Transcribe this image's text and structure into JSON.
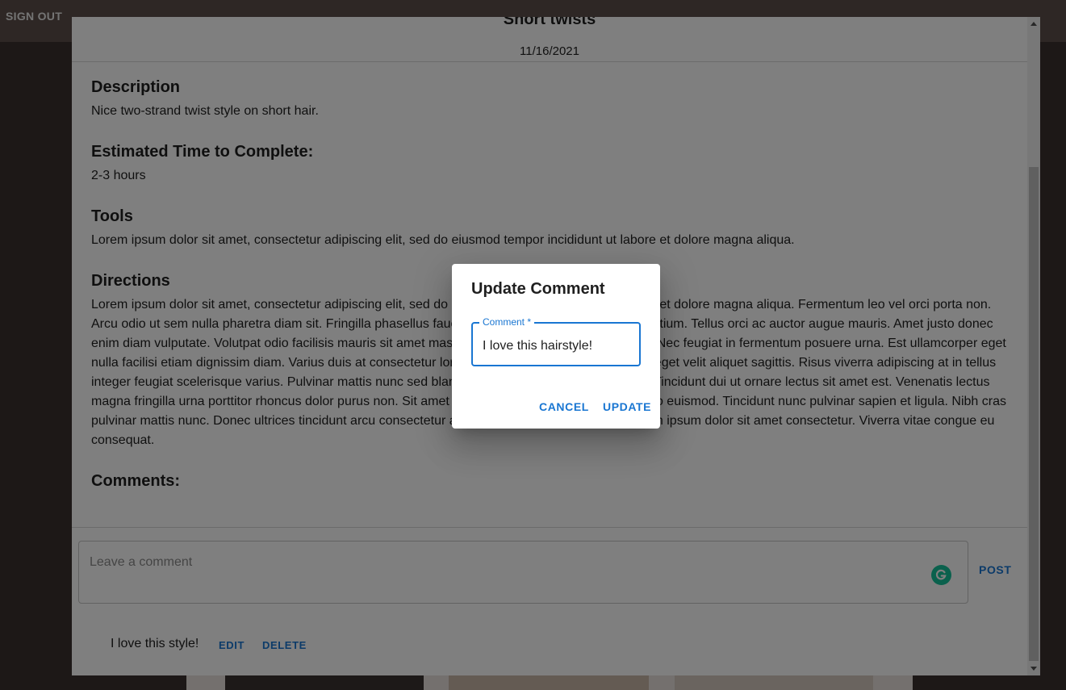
{
  "app_bar": {
    "signout_label": "SIGN OUT"
  },
  "recipe": {
    "title": "Short twists",
    "date": "11/16/2021",
    "sections": {
      "description": {
        "heading": "Description",
        "body": "Nice two-strand twist style on short hair."
      },
      "time": {
        "heading": "Estimated Time to Complete:",
        "body": "2-3 hours"
      },
      "tools": {
        "heading": "Tools",
        "body": "Lorem ipsum dolor sit amet, consectetur adipiscing elit, sed do eiusmod tempor incididunt ut labore et dolore magna aliqua."
      },
      "directions": {
        "heading": "Directions",
        "body": "Lorem ipsum dolor sit amet, consectetur adipiscing elit, sed do eiusmod tempor incididunt ut labore et dolore magna aliqua. Fermentum leo vel orci porta non. Arcu odio ut sem nulla pharetra diam sit. Fringilla phasellus faucibus scelerisque eleifend donec pretium. Tellus orci ac auctor augue mauris. Amet justo donec enim diam vulputate. Volutpat odio facilisis mauris sit amet massa vitae tortor. Aliquet risus viverra. Nec feugiat in fermentum posuere urna. Est ullamcorper eget nulla facilisi etiam dignissim diam. Varius duis at consectetur lorem donec massa sapien. Sed felis eget velit aliquet sagittis. Risus viverra adipiscing at in tellus integer feugiat scelerisque varius. Pulvinar mattis nunc sed blandit. Interdum consectetur libero id. Tincidunt dui ut ornare lectus sit amet est. Venenatis lectus magna fringilla urna porttitor rhoncus dolor purus non. Sit amet nec nam aliquam. Sed arcu non odio euismod. Tincidunt nunc pulvinar sapien et ligula. Nibh cras pulvinar mattis nunc. Donec ultrices tincidunt arcu consectetur a erat nam at lectus urna duis. Lorem ipsum dolor sit amet consectetur. Viverra vitae congue eu consequat."
      },
      "comments": {
        "heading": "Comments:"
      }
    },
    "comment_input": {
      "placeholder": "Leave a comment",
      "value": ""
    },
    "post_label": "POST",
    "existing_comments": [
      {
        "text": "I love this style!",
        "edit_label": "EDIT",
        "delete_label": "DELETE"
      }
    ]
  },
  "update_dialog": {
    "title": "Update Comment",
    "field_label": "Comment *",
    "field_value": "I love this hairstyle!",
    "cancel_label": "CANCEL",
    "update_label": "UPDATE"
  },
  "colors": {
    "accent": "#1976d2",
    "grammarly": "#15c39a",
    "app_bar": "#5c4f4b"
  },
  "icons": {
    "grammarly": "grammarly-icon"
  }
}
